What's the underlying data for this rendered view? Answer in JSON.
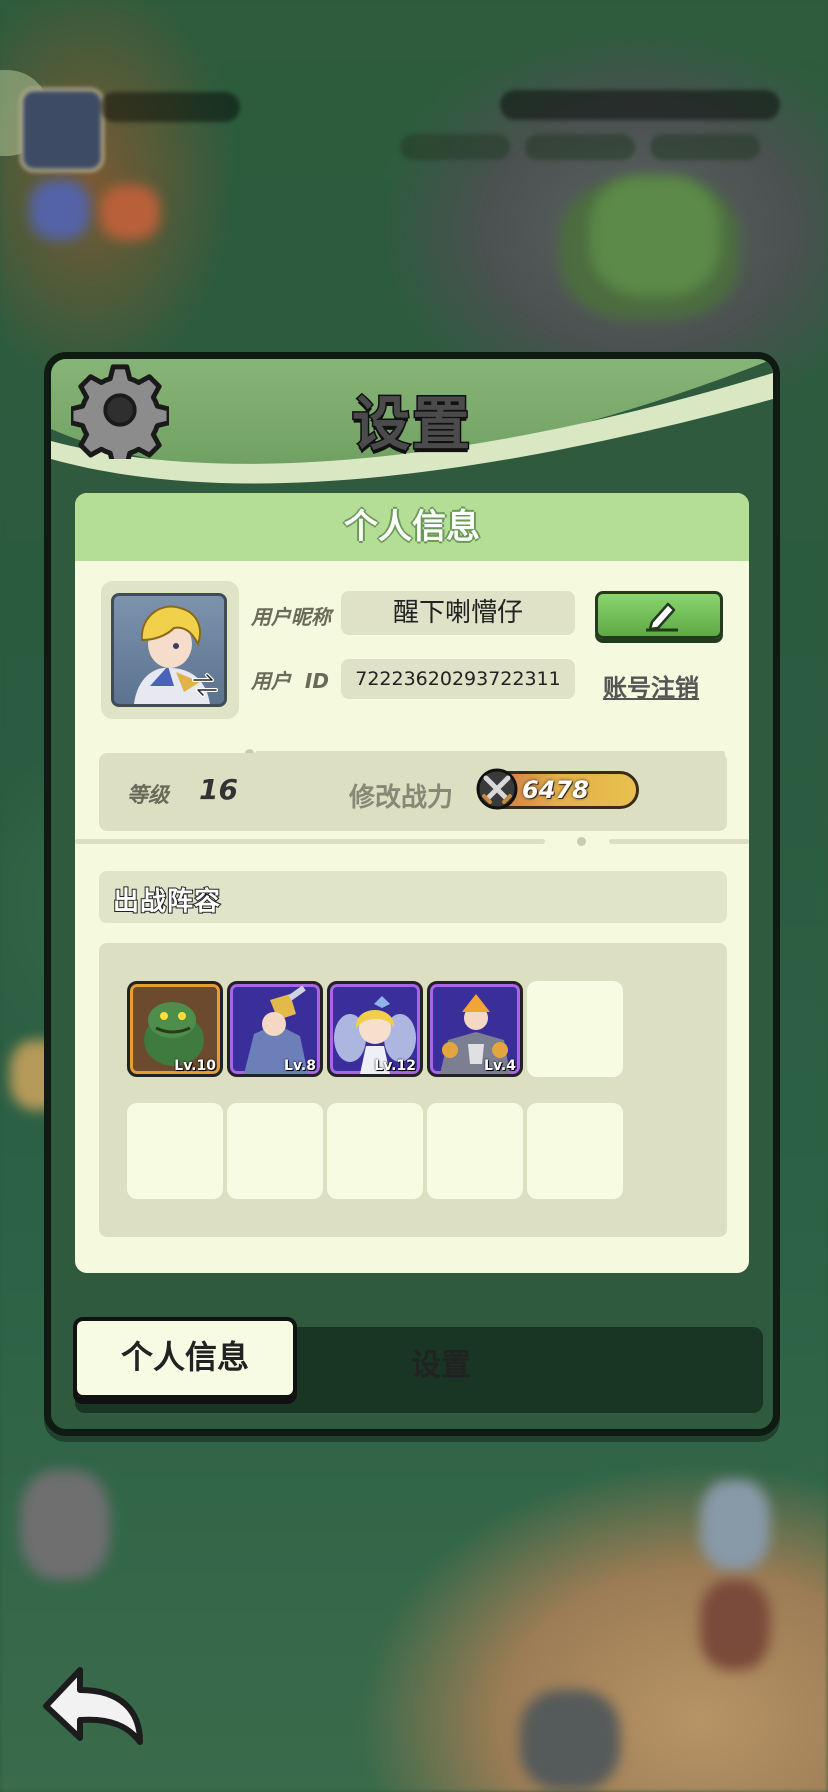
{
  "modal": {
    "title": "设置",
    "panel_title": "个人信息",
    "profile": {
      "nickname_label": "用户昵称",
      "nickname": "醒下喇懵仔",
      "id_label": "用户  ID",
      "user_id": "72223620293722311",
      "cancel_account_label": "账号注销"
    },
    "stats": {
      "level_label": "等级",
      "level": "16",
      "power_label": "修改战力",
      "power": "6478"
    },
    "lineup": {
      "title": "出战阵容",
      "heroes": [
        {
          "level": "Lv.10",
          "rarity": "gold"
        },
        {
          "level": "Lv.8",
          "rarity": "purple"
        },
        {
          "level": "Lv.12",
          "rarity": "purple"
        },
        {
          "level": "Lv.4",
          "rarity": "purple"
        }
      ]
    },
    "tabs": {
      "personal": "个人信息",
      "settings": "设置"
    }
  },
  "icons": {
    "gear": "gear-icon",
    "edit": "pencil-icon",
    "switch": "switch-arrow-icon",
    "power": "crossed-swords-icon",
    "back": "back-arrow-icon"
  },
  "colors": {
    "header_green": "#87b577",
    "panel_bg": "#f5f9dd",
    "edit_green": "#6fbf55",
    "power_gold": "#e3b14a",
    "rarity_gold": "#e79d32",
    "rarity_purple": "#a865e8"
  }
}
